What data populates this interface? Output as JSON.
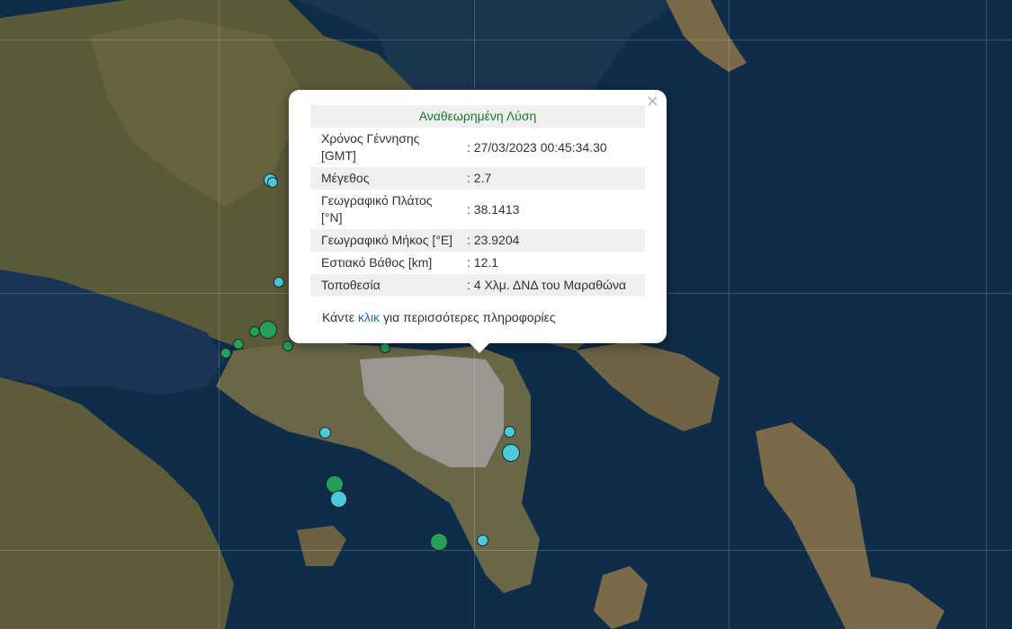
{
  "map": {
    "colors": {
      "sea": "#0f2c48",
      "land": "#5c5a3a",
      "city": "#9a9690",
      "quake_teal": "#4cc9dc",
      "quake_green": "#25a05a"
    },
    "quakes": [
      {
        "color": "teal",
        "size": "medium"
      },
      {
        "color": "teal",
        "size": "medium"
      },
      {
        "color": "teal",
        "size": "small"
      },
      {
        "color": "green",
        "size": "large"
      },
      {
        "color": "green",
        "size": "small"
      },
      {
        "color": "green",
        "size": "small"
      },
      {
        "color": "green",
        "size": "small"
      },
      {
        "color": "green",
        "size": "small"
      },
      {
        "color": "green",
        "size": "small"
      },
      {
        "color": "teal",
        "size": "small"
      },
      {
        "color": "teal",
        "size": "small"
      },
      {
        "color": "teal",
        "size": "large"
      },
      {
        "color": "green",
        "size": "large"
      },
      {
        "color": "teal",
        "size": "large"
      },
      {
        "color": "green",
        "size": "large"
      },
      {
        "color": "teal",
        "size": "small"
      }
    ]
  },
  "popup": {
    "title": "Αναθεωρημένη Λύση",
    "rows": [
      {
        "label": "Χρόνος Γέννησης [GMT]",
        "value": ": 27/03/2023 00:45:34.30"
      },
      {
        "label": "Μέγεθος",
        "value": ": 2.7"
      },
      {
        "label": "Γεωγραφικό Πλάτος [°N]",
        "value": ": 38.1413"
      },
      {
        "label": "Γεωγραφικό Μήκος [°E]",
        "value": ": 23.9204"
      },
      {
        "label": "Εστιακό Βάθος [km]",
        "value": ": 12.1"
      },
      {
        "label": "Τοποθεσία",
        "value": ": 4 Χλμ. ΔΝΔ του Μαραθώνα"
      }
    ],
    "more_prefix": "Κάντε",
    "more_link": "κλικ",
    "more_suffix": "για περισσότερες πληροφορίες",
    "close_label": "×"
  }
}
